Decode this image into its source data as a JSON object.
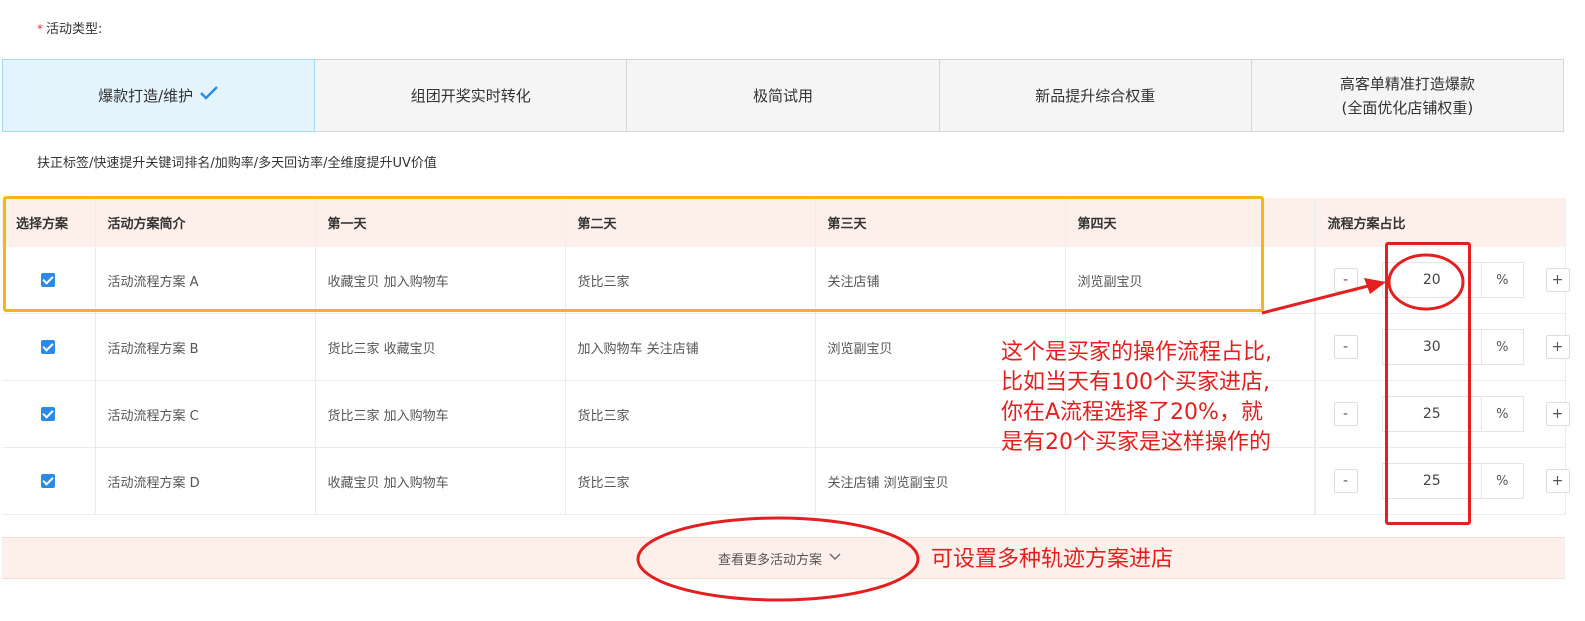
{
  "field": {
    "required_mark": "*",
    "label": "活动类型:"
  },
  "activity_types": [
    {
      "label": "爆款打造/维护",
      "active": true
    },
    {
      "label": "组团开奖实时转化",
      "active": false
    },
    {
      "label": "极简试用",
      "active": false
    },
    {
      "label": "新品提升综合权重",
      "active": false
    },
    {
      "label": "高客单精准打造爆款",
      "label2": "(全面优化店铺权重)",
      "active": false
    }
  ],
  "description": "扶正标签/快速提升关键词排名/加购率/多天回访率/全维度提升UV价值",
  "table": {
    "headers": [
      "选择方案",
      "活动方案简介",
      "第一天",
      "第二天",
      "第三天",
      "第四天",
      "",
      "流程方案占比"
    ],
    "rows": [
      {
        "name": "活动流程方案 A",
        "day1": "收藏宝贝 加入购物车",
        "day2": "货比三家",
        "day3": "关注店铺",
        "day4": "浏览副宝贝",
        "ratio": "20",
        "unit": "%"
      },
      {
        "name": "活动流程方案 B",
        "day1": "货比三家 收藏宝贝",
        "day2": "加入购物车 关注店铺",
        "day3": "浏览副宝贝",
        "day4": "",
        "ratio": "30",
        "unit": "%"
      },
      {
        "name": "活动流程方案 C",
        "day1": "货比三家 加入购物车",
        "day2": "货比三家",
        "day3": "",
        "day4": "",
        "ratio": "25",
        "unit": "%"
      },
      {
        "name": "活动流程方案 D",
        "day1": "收藏宝贝 加入购物车",
        "day2": "货比三家",
        "day3": "关注店铺 浏览副宝贝",
        "day4": "",
        "ratio": "25",
        "unit": "%"
      }
    ],
    "minus": "-",
    "plus": "+"
  },
  "more_link": "查看更多活动方案",
  "annotations": {
    "ratio_note": [
      "这个是买家的操作流程占比,",
      "比如当天有100个买家进店,",
      "你在A流程选择了20%，就",
      "是有20个买家是这样操作的"
    ],
    "more_note": "可设置多种轨迹方案进店"
  },
  "colors": {
    "active_tab_bg": "#e4f4fd",
    "header_bg": "#fdf0ea",
    "check_blue": "#2b8ae6",
    "annotation_red": "#e31f1f",
    "highlight_yellow": "#f7b519"
  },
  "icons": {
    "selected": "checkmark-icon",
    "expand": "chevron-down-icon"
  }
}
